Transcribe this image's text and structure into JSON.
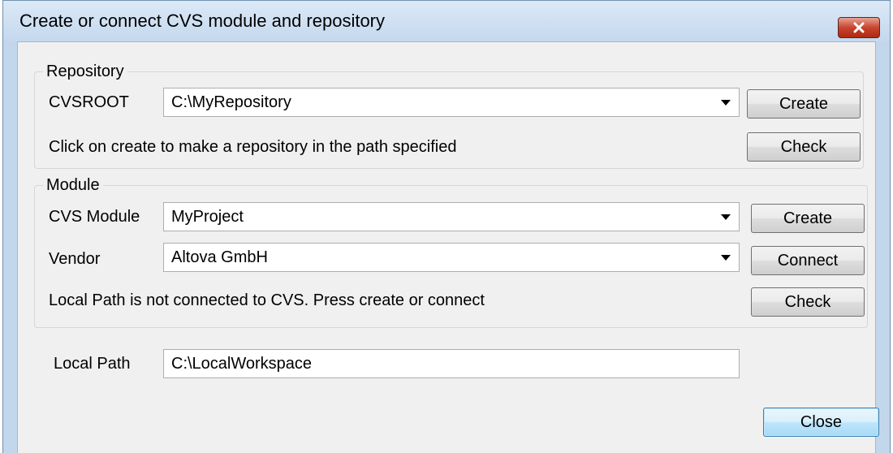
{
  "window": {
    "title": "Create or connect CVS module and repository"
  },
  "repository": {
    "legend": "Repository",
    "cvsroot_label": "CVSROOT",
    "cvsroot_value": "C:\\MyRepository",
    "create_label": "Create",
    "check_label": "Check",
    "status": "Click on create to make a repository in the path specified"
  },
  "module": {
    "legend": "Module",
    "module_label": "CVS Module",
    "module_value": "MyProject",
    "vendor_label": "Vendor",
    "vendor_value": "Altova GmbH",
    "create_label": "Create",
    "connect_label": "Connect",
    "check_label": "Check",
    "status": "Local Path is not connected to CVS. Press create or connect"
  },
  "local_path": {
    "label": "Local Path",
    "value": "C:\\LocalWorkspace"
  },
  "footer": {
    "close_label": "Close"
  },
  "icons": {
    "close": "close-icon",
    "dropdown": "chevron-down-icon"
  },
  "colors": {
    "title_bar": "#c4d8ee",
    "close_button": "#c7452e",
    "client": "#f0f0f0"
  }
}
